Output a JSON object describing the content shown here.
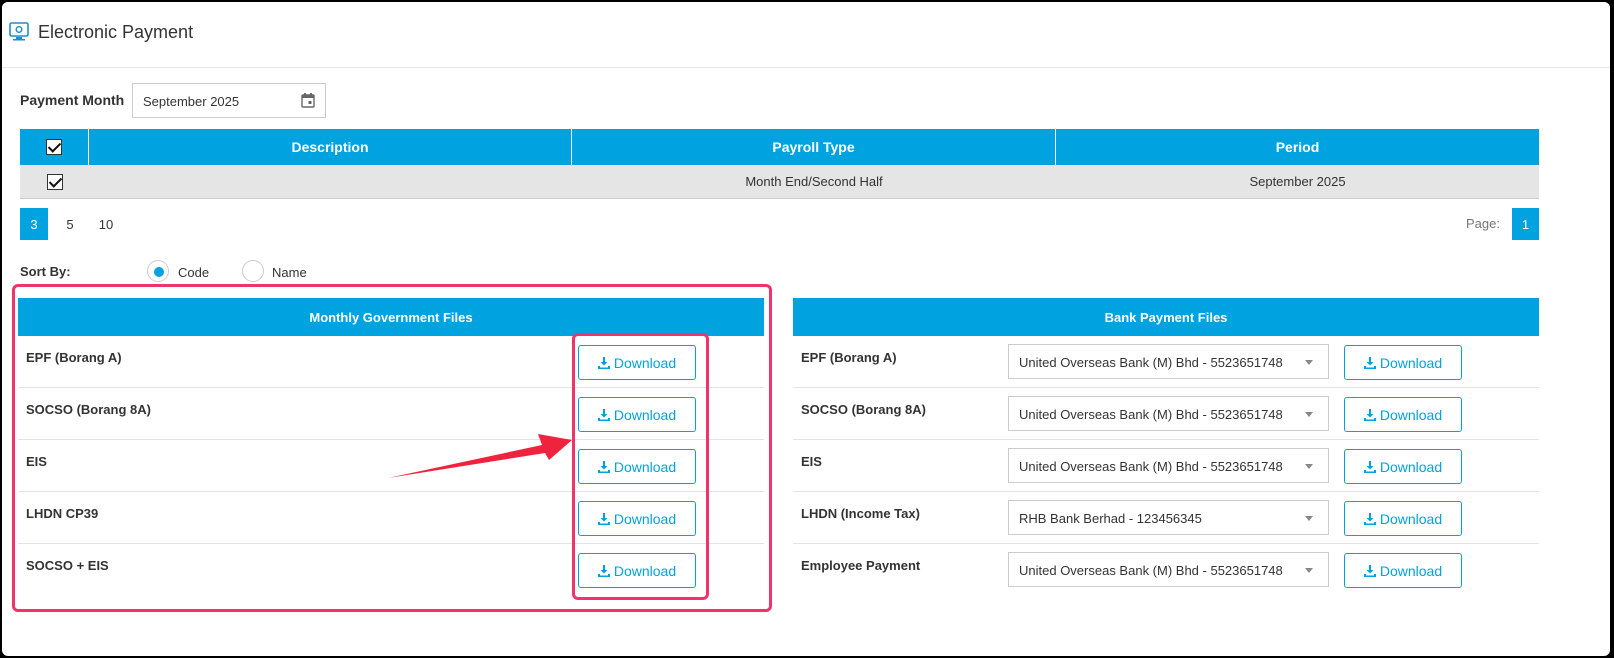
{
  "header": {
    "title": "Electronic Payment",
    "icon": "monitor-settings-icon"
  },
  "filter": {
    "label": "Payment Month",
    "value": "September 2025",
    "icon": "calendar-icon"
  },
  "table": {
    "columns": [
      "Description",
      "Payroll Type",
      "Period"
    ],
    "rows": [
      {
        "description": "",
        "payroll_type": "Month End/Second Half",
        "period": "September 2025",
        "checked": true
      }
    ]
  },
  "pagination": {
    "sizes": [
      "3",
      "5",
      "10"
    ],
    "active_size": "3",
    "page_label": "Page:",
    "current_page": "1"
  },
  "sort": {
    "label": "Sort By:",
    "options": [
      "Code",
      "Name"
    ],
    "selected": "Code"
  },
  "gov_files": {
    "title": "Monthly Government Files",
    "download_label": "Download",
    "items": [
      "EPF (Borang A)",
      "SOCSO (Borang 8A)",
      "EIS",
      "LHDN CP39",
      "SOCSO + EIS"
    ]
  },
  "bank_files": {
    "title": "Bank Payment Files",
    "download_label": "Download",
    "items": [
      {
        "name": "EPF (Borang A)",
        "bank": "United Overseas Bank (M) Bhd - 5523651748"
      },
      {
        "name": "SOCSO (Borang 8A)",
        "bank": "United Overseas Bank (M) Bhd - 5523651748"
      },
      {
        "name": "EIS",
        "bank": "United Overseas Bank (M) Bhd - 5523651748"
      },
      {
        "name": "LHDN (Income Tax)",
        "bank": "RHB Bank Berhad - 123456345"
      },
      {
        "name": "Employee Payment",
        "bank": "United Overseas Bank (M) Bhd - 5523651748"
      }
    ]
  },
  "colors": {
    "accent": "#00a3e0",
    "annotation": "#f0336a"
  }
}
